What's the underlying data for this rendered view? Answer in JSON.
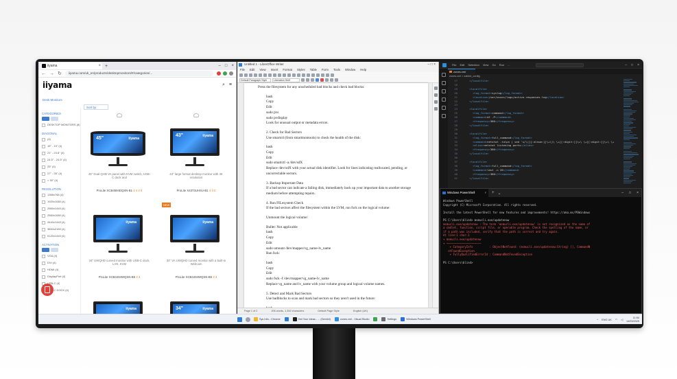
{
  "browser": {
    "tab_title": "iiyama",
    "url": "iiyama.com/uk_en/products/desktopmonitors/#/categories/...",
    "logo": "iiyama",
    "breadcrumb": "Desk Monitors",
    "sort_label": "Sort by",
    "filters": {
      "groups": [
        {
          "title": "CATEGORIES",
          "items": [
            "DESKTOP MONITORS (8)"
          ]
        },
        {
          "title": "DIAGONAL",
          "items": [
            "(4)",
            "15\" - 19\" (4)",
            "21\" - 23.8\" (4)",
            "24.5\" - 24.5\" (4)",
            "25\" (4)",
            "27\" - 28\" (4)",
            "> 30\" (4)"
          ]
        },
        {
          "title": "RESOLUTION",
          "items": [
            "1366x768 (4)",
            "1920x1080 (4)",
            "2560x1440 (4)",
            "2560x1080 (4)",
            "3440x1440 (4)",
            "3840x2160 (4)",
            "5120x1440 (4)"
          ]
        },
        {
          "title": "ACTIVATION",
          "items": [
            "VGA (4)",
            "DVI (4)",
            "HDMI (4)",
            "DisplayPort (4)",
            "USB-C (4)",
            "USB-C DOCK (4)"
          ]
        }
      ]
    },
    "products": [
      {
        "inch": "45\"",
        "brand": "iiyama",
        "desc": "45\" Dual QHD VA panel with KVM switch, USB-C dock and",
        "code": "ProLite XCB4594DQSN-B1",
        "code_suffix": "1 4 4 0"
      },
      {
        "inch": "43\"",
        "brand": "iiyama",
        "desc": "43\" large format desktop monitor with 4K resolution",
        "code": "ProLite X4373UHSU-B1",
        "code_suffix": "4 3 0"
      },
      {
        "inch": "",
        "brand": "iiyama",
        "desc": "34\" UWQHD curved monitor with USB-C dock, LAN, KVM",
        "code": "ProLite XCB3494WQSN-B5",
        "code_suffix": "3 4"
      },
      {
        "inch": "",
        "brand": "iiyama",
        "desc": "34\" VA UWQHD curved monitor with a built-in Webcam",
        "code": "ProLite XCB3494WQSN-B5",
        "code_suffix": "3 4",
        "badge": "NEW"
      },
      {
        "inch": "",
        "brand": "iiyama",
        "desc": "",
        "code": "",
        "code_suffix": ""
      },
      {
        "inch": "34\"",
        "brand": "iiyama",
        "desc": "",
        "code": "",
        "code_suffix": ""
      }
    ]
  },
  "writer": {
    "title": "Untitled 1 - LibreOffice Writer",
    "menu": [
      "File",
      "Edit",
      "View",
      "Insert",
      "Format",
      "Styles",
      "Table",
      "Form",
      "Tools",
      "Window",
      "Help"
    ],
    "style_box": "Default Paragraph Style",
    "font_box": "Liberation Serif",
    "doc_lines": [
      {
        "t": "Press the filesystem for any unscheduled bad blocks and check bad blocks:",
        "i": 0
      },
      {
        "t": "",
        "i": 0
      },
      {
        "t": "bash",
        "i": 1
      },
      {
        "t": "Copy",
        "i": 1
      },
      {
        "t": "Edit",
        "i": 1
      },
      {
        "t": "sudo pvs",
        "i": 1
      },
      {
        "t": "sudo pvdisplay",
        "i": 1
      },
      {
        "t": "Look for unusual output or metadata errors.",
        "i": 1
      },
      {
        "t": "",
        "i": 0
      },
      {
        "t": "2. Check for Bad Sectors",
        "i": 1
      },
      {
        "t": "Use smartctl (from smartmontools) to check the health of the disk:",
        "i": 1
      },
      {
        "t": "",
        "i": 0
      },
      {
        "t": "bash",
        "i": 1
      },
      {
        "t": "Copy",
        "i": 1
      },
      {
        "t": "Edit",
        "i": 1
      },
      {
        "t": "sudo smartctl -a /dev/sdX",
        "i": 1
      },
      {
        "t": "Replace /dev/sdX with your actual disk identifier. Look for lines indicating reallocated, pending, or",
        "i": 1
      },
      {
        "t": "uncorrectable sectors.",
        "i": 1
      },
      {
        "t": "",
        "i": 0
      },
      {
        "t": "3. Backup Important Data",
        "i": 1
      },
      {
        "t": "If a bad sector can indicate a failing disk, immediately back up your important data to another storage",
        "i": 1
      },
      {
        "t": "medium before attempting repairs.",
        "i": 1
      },
      {
        "t": "",
        "i": 0
      },
      {
        "t": "4. Run FILesystem Check",
        "i": 1
      },
      {
        "t": "If the bad sectors affect the filesystem within the LVM, run fsck on the logical volume:",
        "i": 1
      },
      {
        "t": "",
        "i": 0
      },
      {
        "t": "Unmount the logical volume:",
        "i": 1
      },
      {
        "t": "",
        "i": 0
      },
      {
        "t": "Bullet: Not applicable",
        "i": 1
      },
      {
        "t": "bash",
        "i": 1
      },
      {
        "t": "Copy",
        "i": 1
      },
      {
        "t": "Edit",
        "i": 1
      },
      {
        "t": "sudo umount /dev/mapper/vg_name-lv_name",
        "i": 1
      },
      {
        "t": "Run fsck:",
        "i": 1
      },
      {
        "t": "",
        "i": 0
      },
      {
        "t": "bash",
        "i": 1
      },
      {
        "t": "Copy",
        "i": 1
      },
      {
        "t": "Edit",
        "i": 1
      },
      {
        "t": "sudo fsck -f /dev/mapper/vg_name-lv_name",
        "i": 1
      },
      {
        "t": "Replace vg_name and lv_name with your volume group and logical volume names.",
        "i": 1
      },
      {
        "t": "",
        "i": 0
      },
      {
        "t": "5. Detect and Mark Bad Sectors",
        "i": 1
      },
      {
        "t": "Use badblocks to scan and mark bad sectors so they aren't used in the future:",
        "i": 1
      },
      {
        "t": "",
        "i": 0
      },
      {
        "t": "bash",
        "i": 1
      },
      {
        "t": "Copy",
        "i": 1
      },
      {
        "t": "Edit",
        "i": 1
      }
    ],
    "status": [
      "Page 1 of 2",
      "206 words, 1,392 characters",
      "Default Page Style",
      "English (UK)"
    ]
  },
  "vscode": {
    "menu": [
      "File",
      "Edit",
      "Selection",
      "View",
      "Go",
      "Run",
      "..."
    ],
    "tab": "zones.xml",
    "breadcrumb": "zones.xml > zabbix_config",
    "code": [
      {
        "ln": "17",
        "t": "    </localfile>"
      },
      {
        "ln": "18",
        "t": ""
      },
      {
        "ln": "19",
        "t": "    <localfile>"
      },
      {
        "ln": "20",
        "t": "      <log_format>syslog</log_format>"
      },
      {
        "ln": "21",
        "t": "      <location>/var/ossec/logs/active-responses.log</location>"
      },
      {
        "ln": "22",
        "t": "    </localfile>"
      },
      {
        "ln": "23",
        "t": ""
      },
      {
        "ln": "24",
        "t": "    <localfile>"
      },
      {
        "ln": "25",
        "t": "      <log_format>command</log_format>"
      },
      {
        "ln": "26",
        "t": "      <command>df -P</command>"
      },
      {
        "ln": "27",
        "t": "      <frequency>360</frequency>"
      },
      {
        "ln": "28",
        "t": "    </localfile>"
      },
      {
        "ln": "29",
        "t": ""
      },
      {
        "ln": "30",
        "t": "    <localfile>"
      },
      {
        "ln": "31",
        "t": "      <log_format>full_command</log_format>"
      },
      {
        "ln": "32",
        "t": "      <command>netstat -tulpn | sed 's/\\([[:alnum:]]\\+\\)\\ \\+[[:digit:]]\\+\\ \\+[[:digit:]]\\+\\ \\+"
      },
      {
        "ln": "33",
        "t": "      <alias>netstat listening ports</alias>"
      },
      {
        "ln": "34",
        "t": "      <frequency>360</frequency>"
      },
      {
        "ln": "35",
        "t": "    </localfile>"
      },
      {
        "ln": "36",
        "t": ""
      },
      {
        "ln": "37",
        "t": "    <localfile>"
      },
      {
        "ln": "38",
        "t": "      <log_format>full_command</log_format>"
      },
      {
        "ln": "39",
        "t": "      <command>last -n 20</command>"
      },
      {
        "ln": "40",
        "t": "      <frequency>360</frequency>"
      },
      {
        "ln": "41",
        "t": "    </localfile>"
      }
    ]
  },
  "powershell": {
    "tab_title": "Windows PowerShell",
    "lines": [
      {
        "t": "Windows PowerShell",
        "c": ""
      },
      {
        "t": "Copyright (C) Microsoft Corporation. All rights reserved.",
        "c": ""
      },
      {
        "t": "",
        "c": ""
      },
      {
        "t": "Install the latest PowerShell for new features and improvements! https://aka.ms/PSWindows",
        "c": ""
      },
      {
        "t": "",
        "c": ""
      },
      {
        "t": "PS C:\\Users\\blind> msmucli.exe/updatenow",
        "c": ""
      },
      {
        "t": "msmucli.exe/updatenow : The term 'msmucli.exe/updatenow' is not recognized as the name of",
        "c": "err"
      },
      {
        "t": "a cmdlet, function, script file, or operable program. Check the spelling of the name, or",
        "c": "err"
      },
      {
        "t": "if a path was included, verify that the path is correct and try again.",
        "c": "err"
      },
      {
        "t": "At line:1 char:1",
        "c": "err"
      },
      {
        "t": "+ msmucli.exe/updatenow",
        "c": "err"
      },
      {
        "t": "+ ~~~~~~~~~~~~~~~~~~~~~",
        "c": "err"
      },
      {
        "t": "    + CategoryInfo          : ObjectNotFound: (msmucli.exe/updatenow:String) [], CommandN",
        "c": "err"
      },
      {
        "t": "   otFoundException",
        "c": "err"
      },
      {
        "t": "    + FullyQualifiedErrorId : CommandNotFoundException",
        "c": "err"
      },
      {
        "t": "",
        "c": ""
      },
      {
        "t": "PS C:\\Users\\blind>",
        "c": ""
      }
    ]
  },
  "taskbar": {
    "apps": [
      "Sys Info - Chrome",
      "",
      "Get Your Ideas - ... (Gemini)",
      "zones.xml - Visual Studio",
      "",
      "Settings",
      "Windows PowerShell"
    ],
    "tray_lang": "ENG UK",
    "time": "11:54",
    "date": "14/03/2025"
  },
  "colors": {
    "accent_blue": "#3f7ad1",
    "error_red": "#ee5a5a",
    "vscode_bg": "#1e1e1e",
    "terminal_bg": "#0c0c0c"
  }
}
